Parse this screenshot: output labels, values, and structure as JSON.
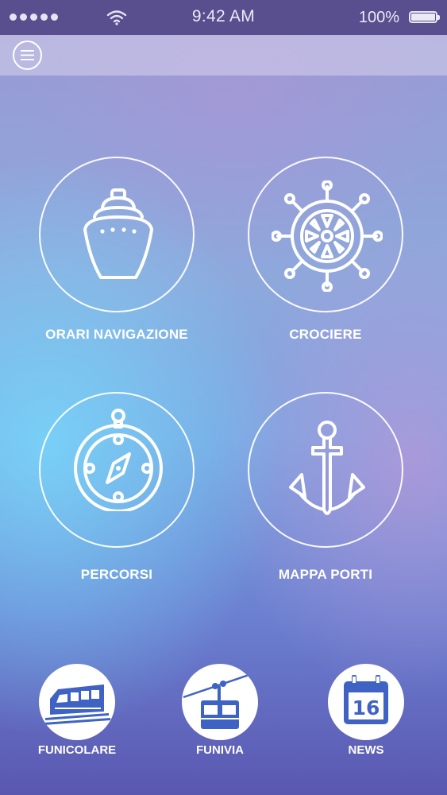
{
  "status_bar": {
    "time": "9:42 AM",
    "battery": "100%",
    "signal_icon": "signal-dots-icon",
    "wifi_icon": "wifi-icon",
    "battery_icon": "battery-icon"
  },
  "nav": {
    "menu_icon": "hamburger-menu-icon"
  },
  "tiles": [
    {
      "label": "ORARI NAVIGAZIONE",
      "icon": "ship-icon"
    },
    {
      "label": "CROCIERE",
      "icon": "ship-wheel-icon"
    },
    {
      "label": "PERCORSI",
      "icon": "compass-icon"
    },
    {
      "label": "MAPPA PORTI",
      "icon": "anchor-icon"
    }
  ],
  "bottom": [
    {
      "label": "FUNICOLARE",
      "icon": "funicular-icon"
    },
    {
      "label": "FUNIVIA",
      "icon": "cable-car-icon"
    },
    {
      "label": "NEWS",
      "icon": "calendar-icon",
      "calendar_day": "16"
    }
  ],
  "colors": {
    "status_bar_bg": "#5a4f8e",
    "icon_blue": "#3f63c4",
    "text": "#ffffff"
  }
}
